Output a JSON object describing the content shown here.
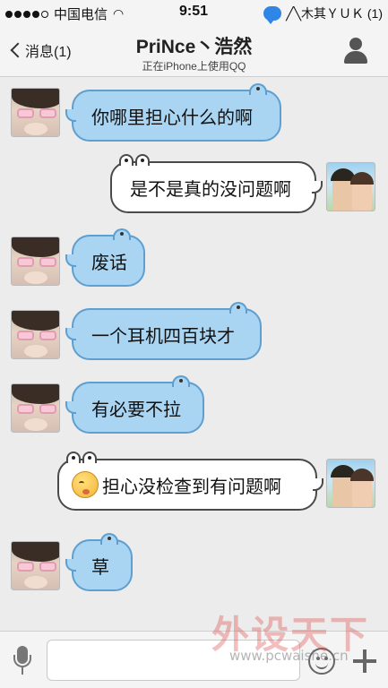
{
  "status_bar": {
    "carrier": "中国电信",
    "time": "9:51",
    "right_text": "╱╲木其ＹＵＫ (1)",
    "icons": [
      "signal-dots-icon",
      "wifi-icon",
      "qq-message-icon"
    ]
  },
  "nav": {
    "back_label": "消息(1)",
    "title": "PriNce丶浩然",
    "subtitle": "正在iPhone上使用QQ",
    "icons": [
      "chevron-left-icon",
      "profile-icon"
    ]
  },
  "messages": [
    {
      "side": "left",
      "text": "你哪里担心什么的啊"
    },
    {
      "side": "right",
      "text": "是不是真的没问题啊"
    },
    {
      "side": "left",
      "text": "废话"
    },
    {
      "side": "left",
      "text": "一个耳机四百块才"
    },
    {
      "side": "left",
      "text": "有必要不拉"
    },
    {
      "side": "right",
      "text": "担心没检查到有问题啊",
      "emoji": "shy-emoji-icon"
    },
    {
      "side": "left",
      "text": "草"
    }
  ],
  "input_bar": {
    "placeholder": "",
    "icons": [
      "microphone-icon",
      "smiley-icon",
      "plus-icon"
    ]
  },
  "watermark": {
    "title": "外设天下",
    "url": "www.pcwaishe.cn"
  },
  "colors": {
    "incoming_bubble": "#a9d5f2",
    "outgoing_bubble": "#ffffff",
    "background": "#ececec"
  }
}
